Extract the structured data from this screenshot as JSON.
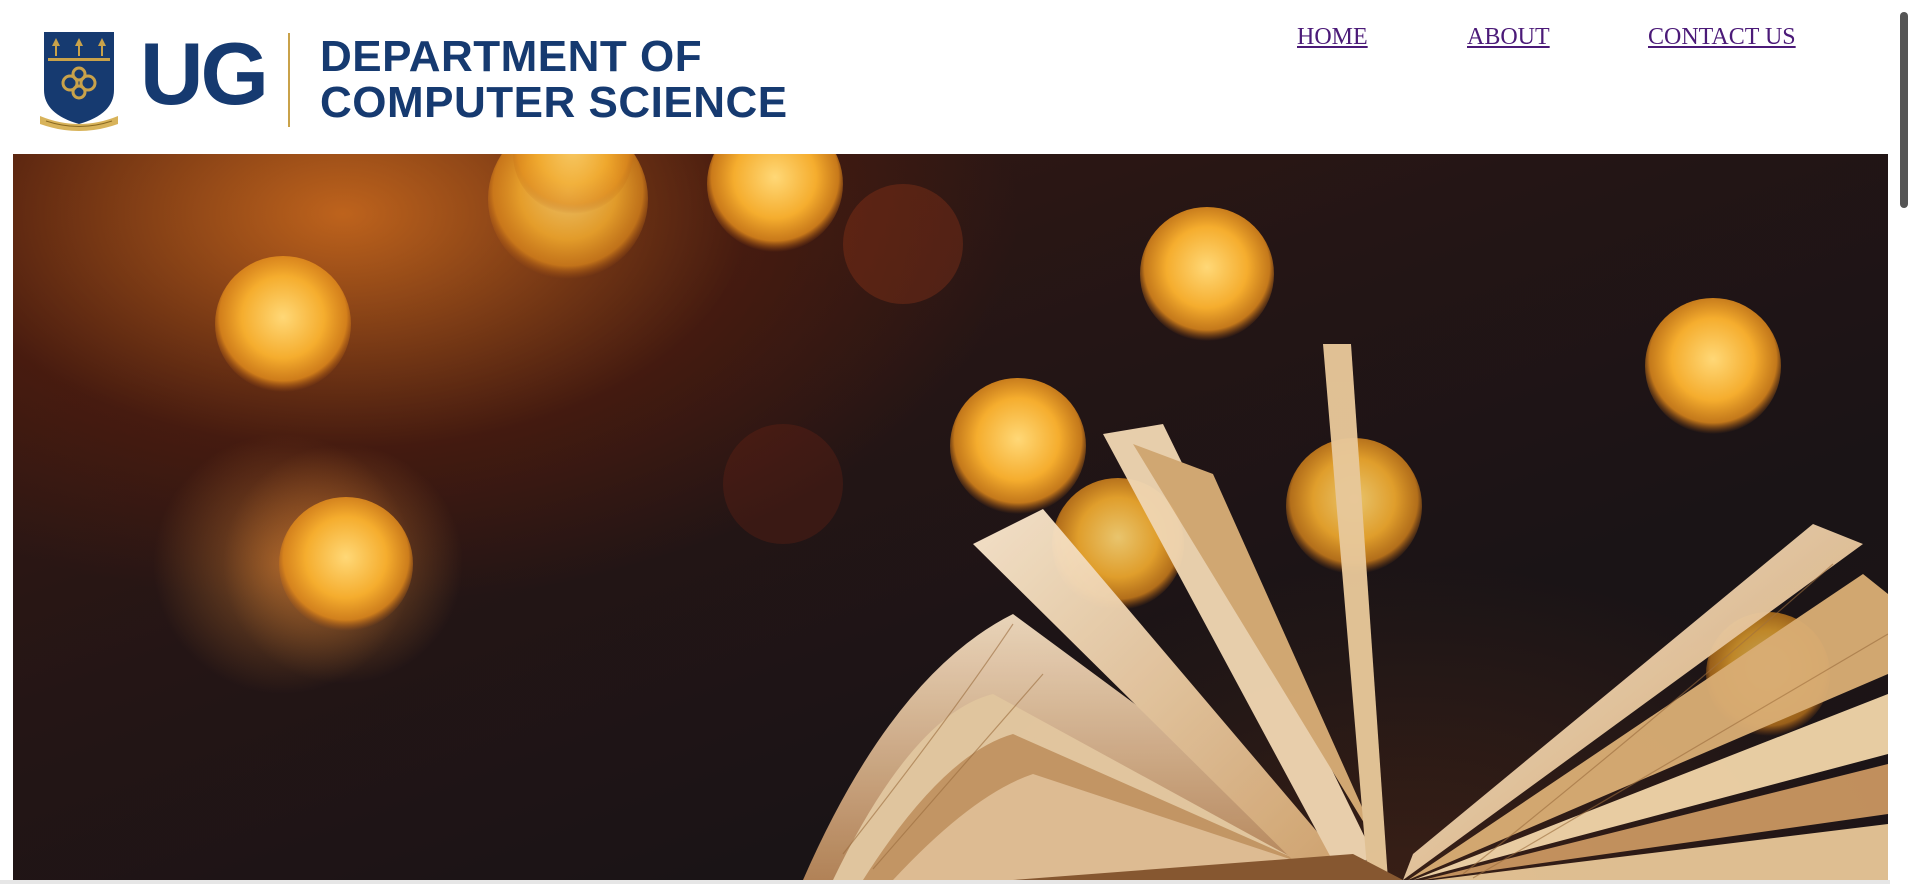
{
  "header": {
    "logo_ug": "UG",
    "logo_dept_line1": "DEPARTMENT OF",
    "logo_dept_line2": "COMPUTER SCIENCE"
  },
  "nav": [
    {
      "label": "HOME"
    },
    {
      "label": "ABOUT"
    },
    {
      "label": "CONTACT US"
    }
  ],
  "colors": {
    "brand_navy": "#163a70",
    "brand_gold": "#c9a24a",
    "link_visited": "#4b1a78"
  },
  "hero": {
    "image_subject": "open book with golden bokeh lights"
  }
}
